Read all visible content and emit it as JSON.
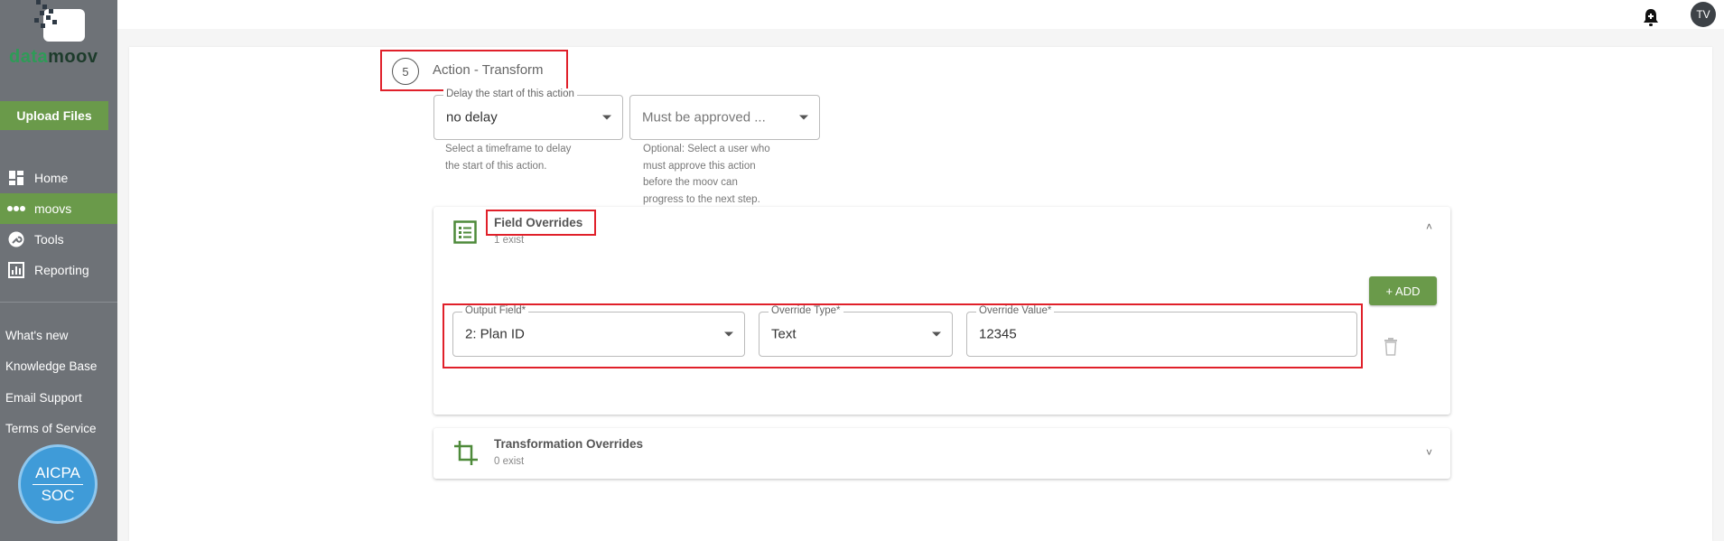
{
  "brand": {
    "logo_part1": "data",
    "logo_part2": "moov",
    "accent": "#6a9a4a",
    "logo_green": "#2e9b57"
  },
  "sidebar": {
    "upload_label": "Upload Files",
    "nav": [
      {
        "label": "Home",
        "icon": "dashboard-icon"
      },
      {
        "label": "moovs",
        "icon": "dots-icon"
      },
      {
        "label": "Tools",
        "icon": "wrench-icon"
      },
      {
        "label": "Reporting",
        "icon": "chart-icon"
      }
    ],
    "links": [
      "What's new",
      "Knowledge Base",
      "Email Support",
      "Terms of Service"
    ],
    "badge": {
      "line1": "AICPA",
      "line2": "SOC"
    }
  },
  "topbar": {
    "avatar_initials": "TV"
  },
  "step": {
    "number": "5",
    "title": "Action - Transform",
    "delay": {
      "label": "Delay the start of this action",
      "value": "no delay",
      "helper": [
        "Select a timeframe to delay",
        "the start of this action."
      ]
    },
    "approval": {
      "value": "Must be approved ...",
      "helper": [
        "Optional: Select a user who",
        "must approve this action",
        "before the moov can",
        "progress to the next step."
      ]
    }
  },
  "field_overrides": {
    "title": "Field Overrides",
    "count": "1 exist",
    "add_label": "+ ADD",
    "row": {
      "output_field_label": "Output Field*",
      "output_field_value": "2: Plan ID",
      "override_type_label": "Override Type*",
      "override_type_value": "Text",
      "override_value_label": "Override Value*",
      "override_value_value": "12345"
    }
  },
  "transformation_overrides": {
    "title": "Transformation Overrides",
    "count": "0 exist"
  }
}
